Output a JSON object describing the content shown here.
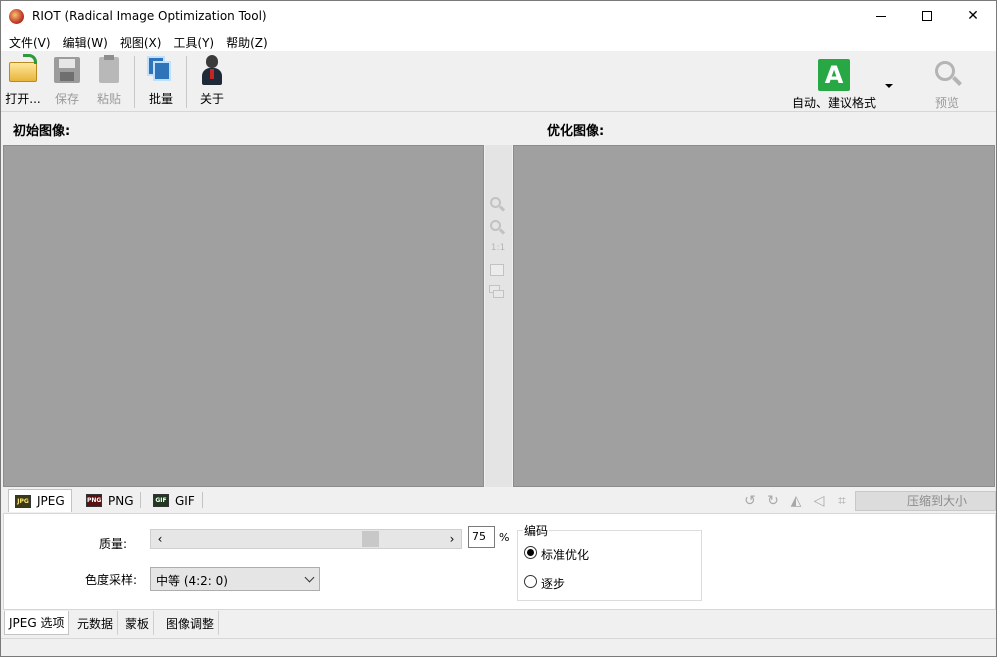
{
  "window": {
    "title": "RIOT (Radical Image Optimization Tool)",
    "controls": [
      "minimize",
      "maximize",
      "close"
    ]
  },
  "menu": [
    "文件(V)",
    "编辑(W)",
    "视图(X)",
    "工具(Y)",
    "帮助(Z)"
  ],
  "toolbar": {
    "open_label": "打开...",
    "save_label": "保存",
    "paste_label": "粘贴",
    "batch_label": "批量",
    "about_label": "关于",
    "auto_label": "自动、建议格式",
    "auto_icon_letter": "A",
    "preview_label": "预览",
    "save_enabled": false,
    "paste_enabled": false,
    "preview_enabled": false
  },
  "panes": {
    "original_title": "初始图像:",
    "optimized_title": "优化图像:",
    "pane_color": "#a0a0a0"
  },
  "zoom_tools": {
    "actual_size_label": "1:1",
    "icons": [
      "zoom-in-icon",
      "zoom-out-icon",
      "fit-icon",
      "compare-icon"
    ]
  },
  "format_tabs": {
    "jpeg": "JPEG",
    "png": "PNG",
    "gif": "GIF",
    "active": "JPEG",
    "compress_label": "压缩到大小",
    "edit_icons": [
      "rotate-left-icon",
      "rotate-right-icon",
      "flip-horizontal-icon",
      "flip-vertical-icon",
      "crop-icon"
    ]
  },
  "jpeg_options": {
    "quality_label": "质量:",
    "quality_value": "75",
    "quality_level": 0.75,
    "percent_symbol": "%",
    "chroma_label": "色度采样:",
    "chroma_value": "中等 (4:2: 0)",
    "encoding_title": "编码",
    "encoding_options": [
      "标准优化",
      "逐步"
    ],
    "encoding_selected": "标准优化"
  },
  "bottom_tabs": {
    "tabs": [
      "JPEG 选项",
      "元数据",
      "蒙板",
      "图像调整"
    ],
    "active": "JPEG 选项"
  },
  "colors": {
    "auto_green": "#27a844",
    "pane_gray": "#a0a0a0",
    "disabled_text": "#9a9a9a"
  }
}
